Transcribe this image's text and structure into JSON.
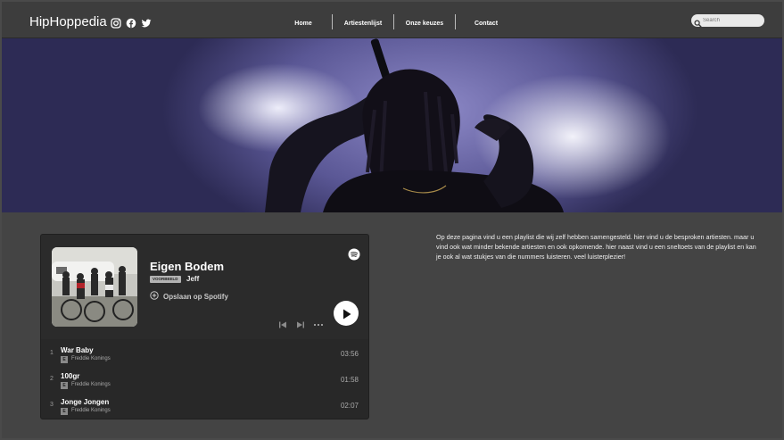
{
  "brand": {
    "name": "HipHoppedia"
  },
  "nav": {
    "items": [
      {
        "label": "Home"
      },
      {
        "label": "Artiestenlijst"
      },
      {
        "label": "Onze keuzes"
      },
      {
        "label": "Contact"
      }
    ],
    "search_placeholder": "Search"
  },
  "player": {
    "title": "Eigen Bodem",
    "badge": "VOORBEELD",
    "owner": "Jeff",
    "save_label": "Opslaan op Spotify",
    "tracks": [
      {
        "num": "1",
        "name": "War Baby",
        "explicit": "E",
        "artist": "Freddie Konings",
        "duration": "03:56"
      },
      {
        "num": "2",
        "name": "100gr",
        "explicit": "E",
        "artist": "Freddie Konings",
        "duration": "01:58"
      },
      {
        "num": "3",
        "name": "Jonge Jongen",
        "explicit": "E",
        "artist": "Freddie Konings",
        "duration": "02:07"
      }
    ]
  },
  "intro": {
    "text": "Op deze pagina vind u een playlist die wij zelf hebben samengesteld. hier vind u de besproken artiesten. maar u vind ook wat minder bekende artiesten en ook opkomende. hier naast vind u een sneltoets van de playlist en kan je ook al wat stukjes van die nummers luisteren. veel luisterplezier!"
  },
  "colors": {
    "background": "#444444",
    "nav": "#3d3d3d",
    "player": "#282828",
    "accent": "#ffffff"
  },
  "icons": [
    "instagram-icon",
    "facebook-icon",
    "twitter-icon",
    "search-icon",
    "spotify-icon",
    "add-circle-icon",
    "previous-icon",
    "next-icon",
    "more-icon",
    "play-icon"
  ]
}
